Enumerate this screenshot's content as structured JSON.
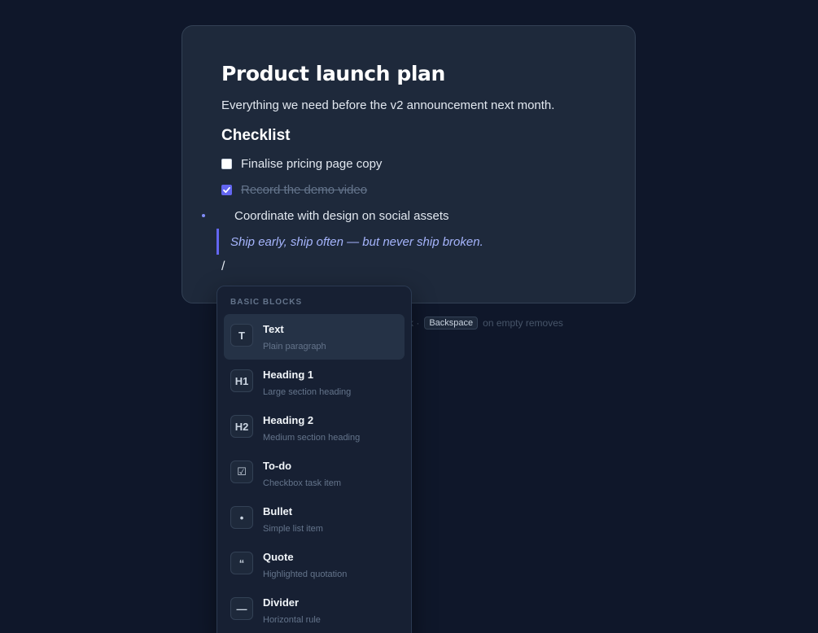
{
  "document": {
    "title": "Product launch plan",
    "intro": "Everything we need before the v2 announcement next month.",
    "section_heading": "Checklist",
    "todos": [
      {
        "label": "Finalise pricing page copy",
        "checked": false
      },
      {
        "label": "Record the demo video",
        "checked": true
      }
    ],
    "bullet": "Coordinate with design on social assets",
    "quote": "Ship early, ship often — but never ship broken.",
    "slash_input": "/"
  },
  "hint": {
    "prefix": "ck ·",
    "key": "Backspace",
    "suffix": "on empty removes"
  },
  "menu": {
    "heading": "BASIC BLOCKS",
    "items": [
      {
        "icon": "T",
        "title": "Text",
        "description": "Plain paragraph",
        "active": true
      },
      {
        "icon": "H1",
        "title": "Heading 1",
        "description": "Large section heading",
        "active": false
      },
      {
        "icon": "H2",
        "title": "Heading 2",
        "description": "Medium section heading",
        "active": false
      },
      {
        "icon": "☑",
        "title": "To-do",
        "description": "Checkbox task item",
        "active": false
      },
      {
        "icon": "•",
        "title": "Bullet",
        "description": "Simple list item",
        "active": false
      },
      {
        "icon": "“",
        "title": "Quote",
        "description": "Highlighted quotation",
        "active": false
      },
      {
        "icon": "—",
        "title": "Divider",
        "description": "Horizontal rule",
        "active": false
      }
    ]
  },
  "colors": {
    "background": "#0f172a",
    "card": "#1e293b",
    "accent": "#6366f1",
    "quote_text": "#a5b4fc"
  }
}
